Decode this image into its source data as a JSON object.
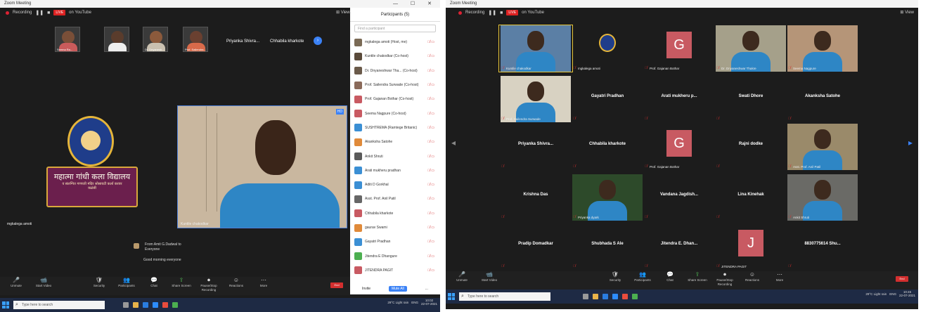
{
  "left": {
    "window_title": "Zoom Meeting",
    "window_controls": "— ☐ ✕",
    "recording_label": "Recording",
    "live_label": "LIVE",
    "live_on_label": "on YouTube",
    "view_label": "View",
    "top_thumbs": [
      {
        "caption": "Seema Ra..."
      },
      {
        "caption": ""
      },
      {
        "caption": "Dr. Dnyanesh..."
      },
      {
        "caption": "Prof. Sailendra..."
      }
    ],
    "top_names": [
      "Priyanka Shivra...",
      "Chhabila kharkote"
    ],
    "logo": {
      "banner_line1": "महात्मा गांधी कला विद्यालय",
      "banner_line2": "व संलग्नित गणपती मंदिर सोसायटी कर्ला करवर",
      "banner_line3": "कळंबी"
    },
    "logo_tile_caption": "mgkalega amoti",
    "main_video": {
      "caption": "Kuntile chakodkar",
      "badge": "HD"
    },
    "chat": {
      "from_line": "From Amit G.Dadwal to",
      "to_line": "Everyone",
      "message": "Good morning everyone"
    },
    "toolbar": [
      {
        "icon": "🎤",
        "label": "Unmute"
      },
      {
        "icon": "📹",
        "label": "Start Video"
      },
      {
        "icon": "🛡",
        "label": "Security"
      },
      {
        "icon": "👥",
        "label": "Participants"
      },
      {
        "icon": "💬",
        "label": "Chat"
      },
      {
        "icon": "⇪",
        "label": "Share Screen"
      },
      {
        "icon": "⏺",
        "label": "Pause/Stop Recording"
      },
      {
        "icon": "☺",
        "label": "Reactions"
      },
      {
        "icon": "⋯",
        "label": "More"
      }
    ],
    "end_label": "End",
    "participants": {
      "title": "Participants (5)",
      "search_placeholder": "Find a participant",
      "rows": [
        {
          "name": "mgkalega amoti (Host, me)",
          "color": "#7a6a55"
        },
        {
          "name": "Kuntile chakodkar (Co-host)",
          "color": "#5a4a3a"
        },
        {
          "name": "Dr. Dnyaneshwar Tha... (Co-host)",
          "color": "#6a5a4a"
        },
        {
          "name": "Prof. Sailendra Surwade (Co-host)",
          "color": "#8a6a5a"
        },
        {
          "name": "Prof. Gajanan Bothar (Co-host)",
          "color": "#c85a62"
        },
        {
          "name": "Seema Nagpure (Co-host)",
          "color": "#c85a62"
        },
        {
          "name": "SUSHTREMA (Ramtege Britanic)",
          "color": "#3b8fd4"
        },
        {
          "name": "Akanksha Satohe",
          "color": "#e08a3a"
        },
        {
          "name": "Ankit Shruti",
          "color": "#5a5a5a"
        },
        {
          "name": "Arati mukheru pradhan",
          "color": "#3b8fd4"
        },
        {
          "name": "Aditi D Gorkhal",
          "color": "#3b8fd4"
        },
        {
          "name": "Asst. Prof. Anil Patil",
          "color": "#666"
        },
        {
          "name": "Chhabila kharkote",
          "color": "#c85a62"
        },
        {
          "name": "gaurav Swami",
          "color": "#e08a3a"
        },
        {
          "name": "Gayatri Pradhan",
          "color": "#3b8fd4"
        },
        {
          "name": "Jitendra E Dhangure",
          "color": "#4caf50"
        },
        {
          "name": "JITENDRA PAGIT",
          "color": "#c85a62"
        }
      ],
      "invite_label": "Invite",
      "mute_all_label": "Mute All",
      "more_label": "..."
    },
    "taskbar": {
      "search_placeholder": "Type here to search",
      "weather": "29°C Light rain",
      "lang": "ENG",
      "time": "10:02",
      "date": "22-07-2021"
    }
  },
  "right": {
    "window_title": "Zoom Meeting",
    "recording_label": "Recording",
    "live_label": "LIVE",
    "live_on_label": "on YouTube",
    "view_label": "View",
    "tiles": [
      {
        "type": "video",
        "caption": "Kuntile chakodkar",
        "bg": "#5b7fa5"
      },
      {
        "type": "logo",
        "caption": "mgkalega amoti"
      },
      {
        "type": "letter",
        "letter": "G",
        "caption": "Prof. Gajanan Bothar"
      },
      {
        "type": "video",
        "caption": "Dr. Dnyaneshwar Thakre",
        "bg": "#a5a08a"
      },
      {
        "type": "video",
        "caption": "Seema Nagpure",
        "bg": "#b59578"
      },
      {
        "type": "video",
        "caption": "Prof. Sailendra Surwade",
        "bg": "#d8d2c2"
      },
      {
        "type": "name",
        "name": "Gayatri Pradhan"
      },
      {
        "type": "name",
        "name": "Arati mukheru p..."
      },
      {
        "type": "name",
        "name": "Swati Dhore"
      },
      {
        "type": "name",
        "name": "Akanksha Satohe"
      },
      {
        "type": "name",
        "name": "Priyanka Shivra..."
      },
      {
        "type": "name",
        "name": "Chhabila kharkote"
      },
      {
        "type": "letter",
        "letter": "G",
        "caption": "Prof. Gajanan Bothar"
      },
      {
        "type": "name",
        "name": "Rajni dodke"
      },
      {
        "type": "video",
        "caption": "Asst. Prof. Anil Patil",
        "bg": "#9a8a6a"
      },
      {
        "type": "name",
        "name": "Krishna Das"
      },
      {
        "type": "video",
        "caption": "Priyanka dyark",
        "bg": "#2d4a2a"
      },
      {
        "type": "name",
        "name": "Vandana Jagdish..."
      },
      {
        "type": "name",
        "name": "Lina Kinehak"
      },
      {
        "type": "video",
        "caption": "Ankit Shruti",
        "bg": "#6a6a66"
      },
      {
        "type": "name",
        "name": "Pradip Domadkar"
      },
      {
        "type": "name",
        "name": "Shubhada S Ale"
      },
      {
        "type": "name",
        "name": "Jitendra E. Dhan..."
      },
      {
        "type": "letter",
        "letter": "J",
        "caption": "JITENDRA PAGIT"
      },
      {
        "type": "name",
        "name": "8830775614 Shu..."
      }
    ],
    "toolbar": [
      {
        "icon": "🎤",
        "label": "Unmute"
      },
      {
        "icon": "📹",
        "label": "Start Video"
      },
      {
        "icon": "🛡",
        "label": "Security"
      },
      {
        "icon": "👥",
        "label": "Participants"
      },
      {
        "icon": "💬",
        "label": "Chat"
      },
      {
        "icon": "⇪",
        "label": "Share Screen"
      },
      {
        "icon": "⏺",
        "label": "Pause/Stop Recording"
      },
      {
        "icon": "☺",
        "label": "Reactions"
      },
      {
        "icon": "⋯",
        "label": "More"
      }
    ],
    "end_label": "End",
    "taskbar": {
      "search_placeholder": "Type here to search",
      "weather": "29°C Light rain",
      "lang": "ENG",
      "time": "10:45",
      "date": "22-07-2021"
    }
  }
}
